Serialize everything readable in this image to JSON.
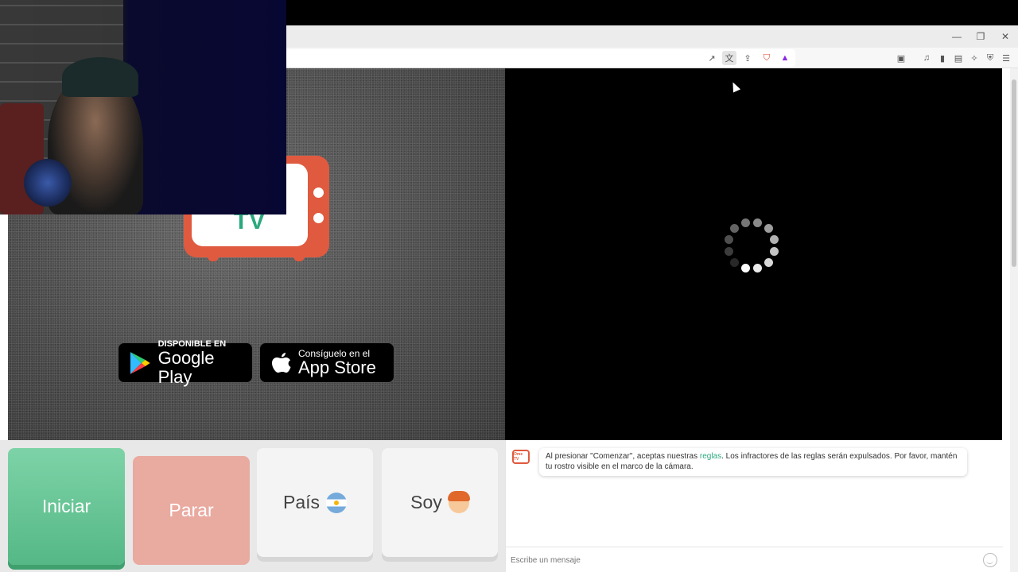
{
  "browser": {
    "window_controls": {
      "minimize": "—",
      "restore": "❐",
      "close": "✕"
    },
    "toolbar_icons": [
      "external-link-icon",
      "translate-icon",
      "share-icon",
      "brave-shield-icon",
      "brave-rewards-icon",
      "screenshot-icon",
      "music-icon",
      "sidebar-icon",
      "wallet-icon",
      "leo-icon",
      "vpn-icon",
      "menu-icon"
    ]
  },
  "left_video": {
    "logo_text": "TV",
    "google_play": {
      "small": "DISPONIBLE EN",
      "big": "Google Play"
    },
    "app_store": {
      "small": "Consíguelo en el",
      "big": "App Store"
    }
  },
  "controls": {
    "start_label": "Iniciar",
    "stop_label": "Parar",
    "country_label": "País",
    "gender_label": "Soy"
  },
  "chat": {
    "avatar_text": "Ome TV",
    "message_before_link": "Al presionar \"Comenzar\", aceptas nuestras ",
    "message_link": "reglas",
    "message_after_link": ". Los infractores de las reglas serán expulsados. Por favor, mantén tu rostro visible en el marco de la cámara.",
    "input_placeholder": "Escribe un mensaje"
  },
  "colors": {
    "brand_red": "#e05a3f",
    "brand_green": "#2aa87e",
    "start_green": "#55b886",
    "stop_pink": "#e9aaa0"
  }
}
